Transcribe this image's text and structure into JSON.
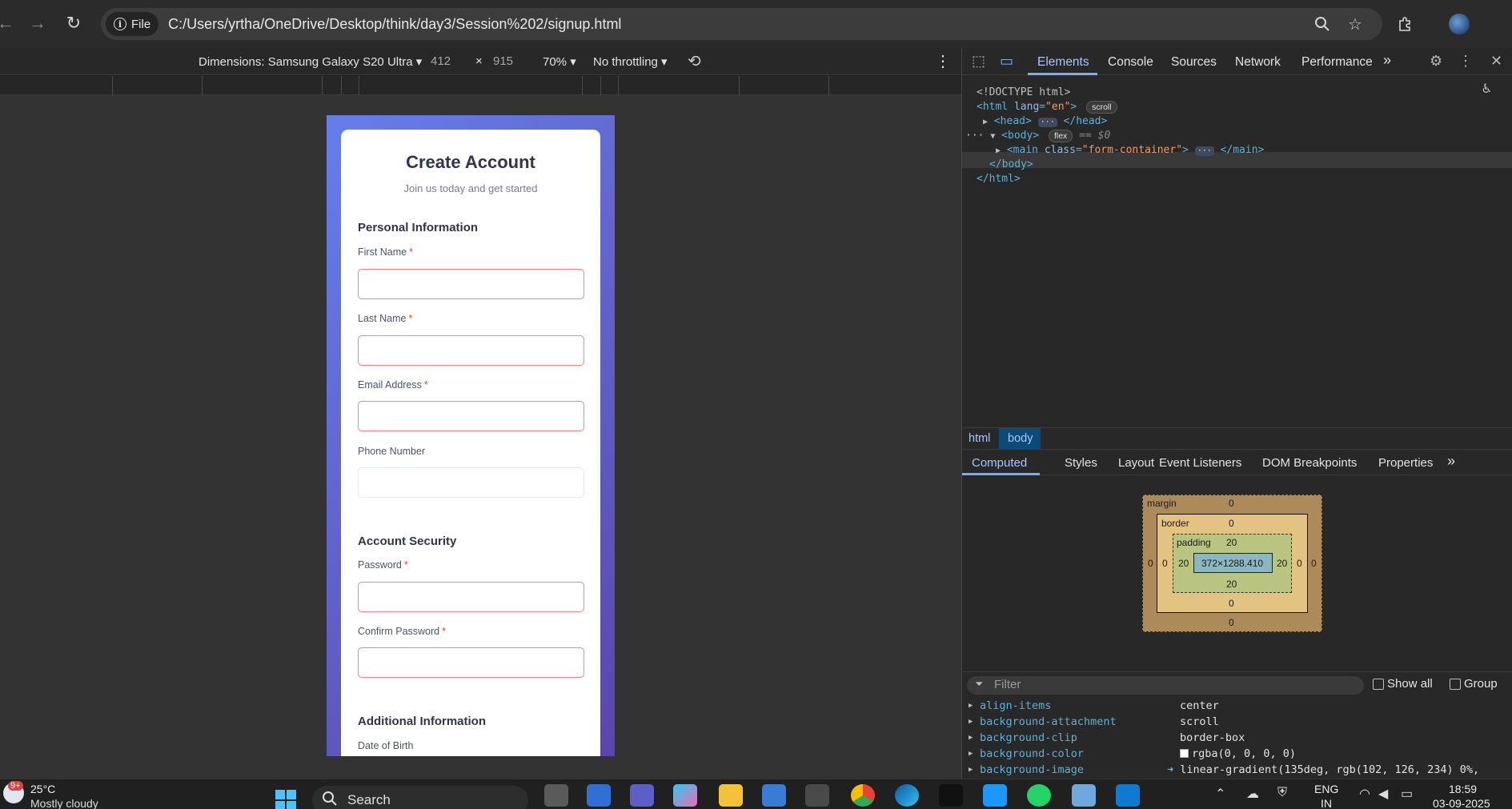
{
  "browser": {
    "site_chip": "File",
    "url": "C:/Users/yrtha/OneDrive/Desktop/think/day3/Session%202/signup.html"
  },
  "device_toolbar": {
    "device": "Dimensions: Samsung Galaxy S20 Ultra",
    "width": "412",
    "times": "×",
    "height": "915",
    "zoom": "70%",
    "throttle": "No throttling"
  },
  "form": {
    "title": "Create Account",
    "subtitle": "Join us today and get started",
    "sections": {
      "personal": "Personal Information",
      "security": "Account Security",
      "additional": "Additional Information"
    },
    "required_mark": "*",
    "labels": {
      "first_name": "First Name",
      "last_name": "Last Name",
      "email": "Email Address",
      "phone": "Phone Number",
      "password": "Password",
      "confirm_password": "Confirm Password",
      "dob": "Date of Birth"
    }
  },
  "devtools": {
    "tabs": [
      "Elements",
      "Console",
      "Sources",
      "Network",
      "Performance"
    ],
    "more": "»",
    "dom": {
      "doctype": "<!DOCTYPE html>",
      "html_open": "<html",
      "lang_attr": "lang",
      "lang_val": "\"en\"",
      "close_bracket": ">",
      "scroll_badge": "scroll",
      "head": "<head>",
      "head_close": "</head>",
      "body_open": "<body>",
      "flex_badge": "flex",
      "eq_sel": "== $0",
      "main_open": "<main",
      "class_attr": "class",
      "class_val": "\"form-container\"",
      "main_close": "</main>",
      "body_close": "</body>",
      "html_close": "</html>",
      "dots": "···"
    },
    "breadcrumbs": [
      "html",
      "body"
    ],
    "sub_tabs": [
      "Computed",
      "Styles",
      "Layout",
      "Event Listeners",
      "DOM Breakpoints",
      "Properties"
    ],
    "box_model": {
      "margin_label": "margin",
      "border_label": "border",
      "padding_label": "padding",
      "margin": [
        "0",
        "0",
        "0",
        "0"
      ],
      "border": [
        "0",
        "0",
        "0",
        "0"
      ],
      "padding": [
        "20",
        "20",
        "20",
        "20"
      ],
      "content": "372×1288.410"
    },
    "filter_placeholder": "Filter",
    "show_all": "Show all",
    "group": "Group",
    "properties": [
      {
        "name": "align-items",
        "value": "center"
      },
      {
        "name": "background-attachment",
        "value": "scroll"
      },
      {
        "name": "background-clip",
        "value": "border-box"
      },
      {
        "name": "background-color",
        "value": "rgba(0, 0, 0, 0)"
      },
      {
        "name": "background-image",
        "value": "linear-gradient(135deg,  rgb(102, 126, 234) 0%,"
      }
    ]
  },
  "taskbar": {
    "weather_temp": "25°C",
    "weather_desc": "Mostly cloudy",
    "badge": "9+",
    "search": "Search",
    "lang": "ENG",
    "lang2": "IN",
    "time": "18:59",
    "date": "03-09-2025"
  }
}
